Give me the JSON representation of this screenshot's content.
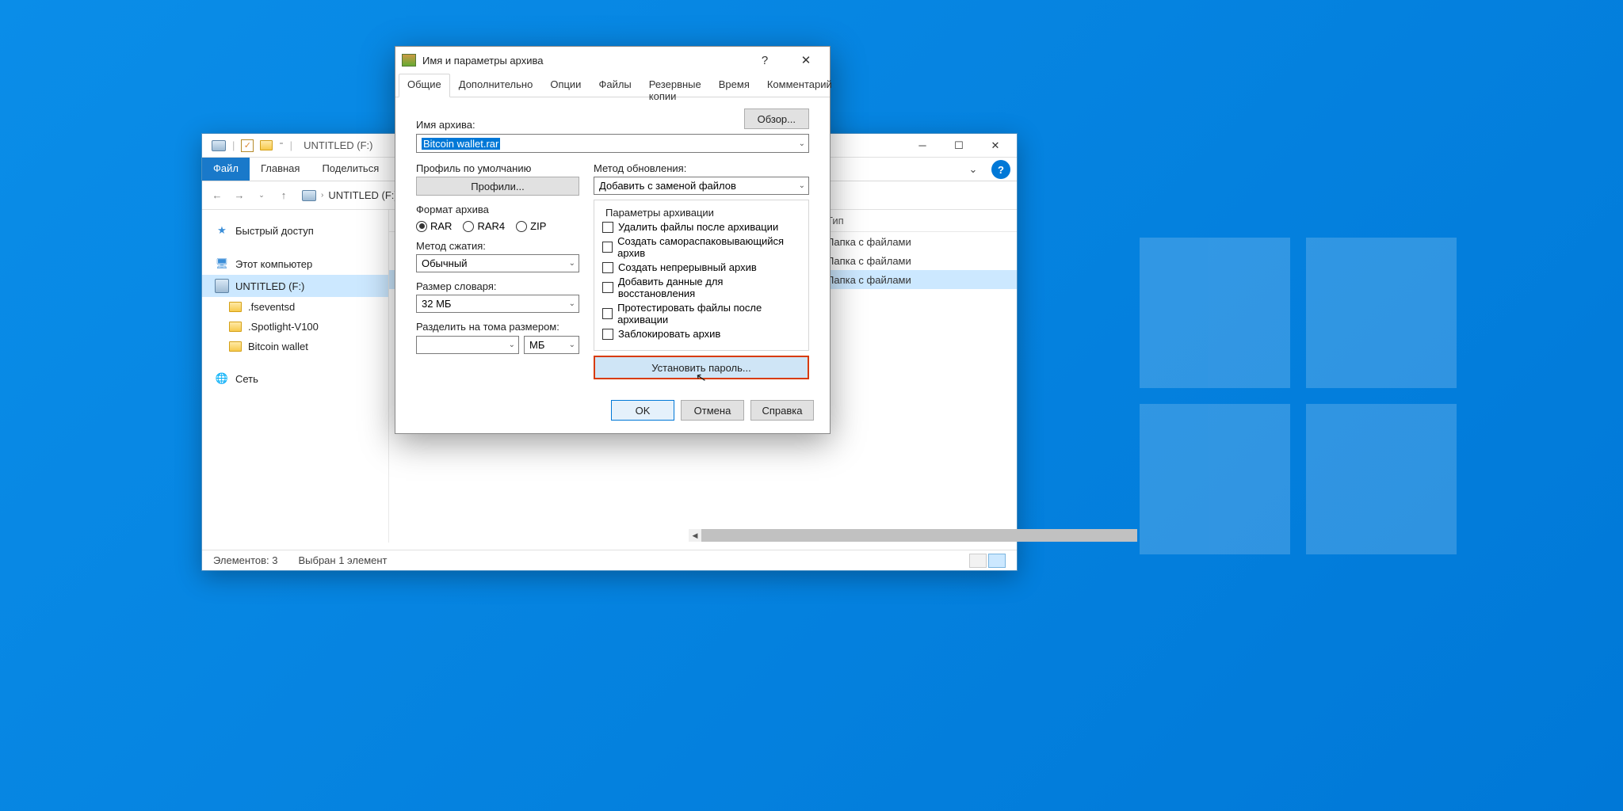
{
  "explorer": {
    "title": "UNTITLED (F:)",
    "ribbon": {
      "file": "Файл",
      "home": "Главная",
      "share": "Поделиться"
    },
    "breadcrumb": "UNTITLED (F:)",
    "sidebar": {
      "quick": "Быстрый доступ",
      "thispc": "Этот компьютер",
      "drive": "UNTITLED (F:)",
      "sub1": ".fseventsd",
      "sub2": ".Spotlight-V100",
      "sub3": "Bitcoin wallet",
      "network": "Сеть"
    },
    "columns": {
      "type": "Тип"
    },
    "rows": {
      "r1": "Папка с файлами",
      "r2": "Папка с файлами",
      "r3": "Папка с файлами"
    },
    "status": {
      "count": "Элементов: 3",
      "selected": "Выбран 1 элемент"
    }
  },
  "dialog": {
    "title": "Имя и параметры архива",
    "tabs": {
      "general": "Общие",
      "advanced": "Дополнительно",
      "options": "Опции",
      "files": "Файлы",
      "backup": "Резервные копии",
      "time": "Время",
      "comment": "Комментарий"
    },
    "archive_name_label": "Имя архива:",
    "archive_name": "Bitcoin wallet.rar",
    "browse": "Обзор...",
    "default_profile": "Профиль по умолчанию",
    "profiles_btn": "Профили...",
    "update_mode_label": "Метод обновления:",
    "update_mode": "Добавить с заменой файлов",
    "format_label": "Формат архива",
    "formats": {
      "rar": "RAR",
      "rar4": "RAR4",
      "zip": "ZIP"
    },
    "compression_label": "Метод сжатия:",
    "compression": "Обычный",
    "dict_label": "Размер словаря:",
    "dict": "32 МБ",
    "split_label": "Разделить на тома размером:",
    "split_unit": "МБ",
    "options_label": "Параметры архивации",
    "opts": {
      "o1": "Удалить файлы после архивации",
      "o2": "Создать самораспаковывающийся архив",
      "o3": "Создать непрерывный архив",
      "o4": "Добавить данные для восстановления",
      "o5": "Протестировать файлы после архивации",
      "o6": "Заблокировать архив"
    },
    "set_password": "Установить пароль...",
    "ok": "OK",
    "cancel": "Отмена",
    "help": "Справка"
  }
}
